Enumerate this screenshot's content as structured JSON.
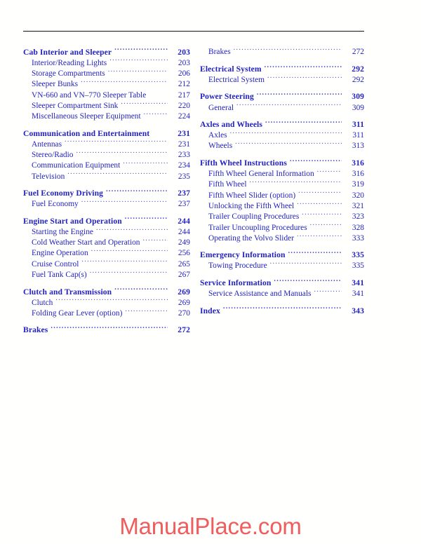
{
  "page": {
    "rule_color": "#141414",
    "text_color": "#2222c0",
    "watermark_color": "#ef5d5d"
  },
  "watermark": {
    "text": "ManualPlace.com"
  },
  "toc": {
    "left_column": [
      {
        "label": "Cab Interior and Sleeper",
        "page": "203",
        "level": "section",
        "leader": true
      },
      {
        "label": "Interior/Reading Lights",
        "page": "203",
        "level": "sub",
        "leader": true
      },
      {
        "label": "Storage Compartments",
        "page": "206",
        "level": "sub",
        "leader": true
      },
      {
        "label": "Sleeper Bunks",
        "page": "212",
        "level": "sub",
        "leader": true
      },
      {
        "label": "VN-660 and VN–770 Sleeper Table",
        "page": "217",
        "level": "sub",
        "leader": false
      },
      {
        "label": "Sleeper Compartment Sink",
        "page": "220",
        "level": "sub",
        "leader": true
      },
      {
        "label": "Miscellaneous Sleeper Equipment",
        "page": "224",
        "level": "sub",
        "leader": true
      },
      {
        "label": "Communication and Entertainment",
        "page": "231",
        "level": "section",
        "leader": false
      },
      {
        "label": "Antennas",
        "page": "231",
        "level": "sub",
        "leader": true
      },
      {
        "label": "Stereo/Radio",
        "page": "233",
        "level": "sub",
        "leader": true
      },
      {
        "label": "Communication Equipment",
        "page": "234",
        "level": "sub",
        "leader": true
      },
      {
        "label": "Television",
        "page": "235",
        "level": "sub",
        "leader": true
      },
      {
        "label": "Fuel Economy Driving",
        "page": "237",
        "level": "section",
        "leader": true
      },
      {
        "label": "Fuel Economy",
        "page": "237",
        "level": "sub",
        "leader": true
      },
      {
        "label": "Engine Start and Operation",
        "page": "244",
        "level": "section",
        "leader": true
      },
      {
        "label": "Starting the Engine",
        "page": "244",
        "level": "sub",
        "leader": true
      },
      {
        "label": "Cold Weather Start and Operation",
        "page": "249",
        "level": "sub",
        "leader": true
      },
      {
        "label": "Engine Operation",
        "page": "256",
        "level": "sub",
        "leader": true
      },
      {
        "label": "Cruise Control",
        "page": "265",
        "level": "sub",
        "leader": true
      },
      {
        "label": "Fuel Tank Cap(s)",
        "page": "267",
        "level": "sub",
        "leader": true
      },
      {
        "label": "Clutch and Transmission",
        "page": "269",
        "level": "section",
        "leader": true
      },
      {
        "label": "Clutch",
        "page": "269",
        "level": "sub",
        "leader": true
      },
      {
        "label": "Folding Gear Lever (option)",
        "page": "270",
        "level": "sub",
        "leader": true
      },
      {
        "label": "Brakes",
        "page": "272",
        "level": "section",
        "leader": true
      }
    ],
    "right_column": [
      {
        "label": "Brakes",
        "page": "272",
        "level": "sub",
        "leader": true
      },
      {
        "label": "Electrical System",
        "page": "292",
        "level": "section",
        "leader": true
      },
      {
        "label": "Electrical System",
        "page": "292",
        "level": "sub",
        "leader": true
      },
      {
        "label": "Power Steering",
        "page": "309",
        "level": "section",
        "leader": true
      },
      {
        "label": "General",
        "page": "309",
        "level": "sub",
        "leader": true
      },
      {
        "label": "Axles and Wheels",
        "page": "311",
        "level": "section",
        "leader": true
      },
      {
        "label": "Axles",
        "page": "311",
        "level": "sub",
        "leader": true
      },
      {
        "label": "Wheels",
        "page": "313",
        "level": "sub",
        "leader": true
      },
      {
        "label": "Fifth Wheel Instructions",
        "page": "316",
        "level": "section",
        "leader": true
      },
      {
        "label": "Fifth Wheel General Information",
        "page": "316",
        "level": "sub",
        "leader": true
      },
      {
        "label": "Fifth Wheel",
        "page": "319",
        "level": "sub",
        "leader": true
      },
      {
        "label": "Fifth Wheel Slider (option)",
        "page": "320",
        "level": "sub",
        "leader": true
      },
      {
        "label": "Unlocking the Fifth Wheel",
        "page": "321",
        "level": "sub",
        "leader": true
      },
      {
        "label": "Trailer Coupling Procedures",
        "page": "323",
        "level": "sub",
        "leader": true
      },
      {
        "label": "Trailer Uncoupling Procedures",
        "page": "328",
        "level": "sub",
        "leader": true
      },
      {
        "label": "Operating the Volvo Slider",
        "page": "333",
        "level": "sub",
        "leader": true
      },
      {
        "label": "Emergency Information",
        "page": "335",
        "level": "section",
        "leader": true
      },
      {
        "label": "Towing Procedure",
        "page": "335",
        "level": "sub",
        "leader": true
      },
      {
        "label": "Service Information",
        "page": "341",
        "level": "section",
        "leader": true
      },
      {
        "label": "Service Assistance and Manuals",
        "page": "341",
        "level": "sub",
        "leader": true
      },
      {
        "label": "Index",
        "page": "343",
        "level": "section",
        "leader": true
      }
    ]
  }
}
